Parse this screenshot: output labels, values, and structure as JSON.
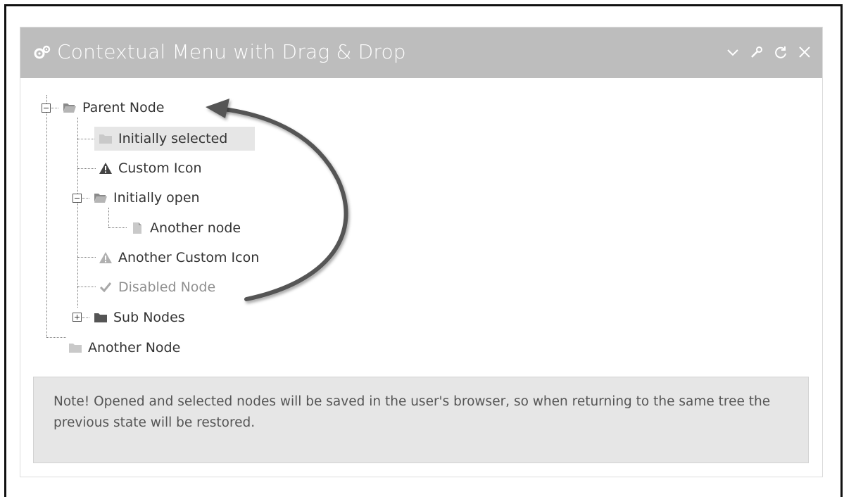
{
  "panel": {
    "title": "Contextual Menu with Drag & Drop",
    "title_icon": "cogs-icon",
    "toolbar": [
      {
        "name": "collapse",
        "icon": "chevron-down-icon"
      },
      {
        "name": "settings",
        "icon": "wrench-icon"
      },
      {
        "name": "refresh",
        "icon": "refresh-icon"
      },
      {
        "name": "close",
        "icon": "close-icon"
      }
    ]
  },
  "tree": {
    "parent": {
      "label": "Parent Node",
      "icon": "folder-open-icon",
      "expanded": true
    },
    "children": [
      {
        "label": "Initially selected",
        "icon": "folder-icon",
        "selected": true
      },
      {
        "label": "Custom Icon",
        "icon": "warning-icon"
      },
      {
        "label": "Initially open",
        "icon": "folder-open-icon",
        "expanded": true,
        "children": [
          {
            "label": "Another node",
            "icon": "file-icon"
          }
        ]
      },
      {
        "label": "Another Custom Icon",
        "icon": "warning-icon-light"
      },
      {
        "label": "Disabled Node",
        "icon": "check-icon",
        "disabled": true
      },
      {
        "label": "Sub Nodes",
        "icon": "folder-dark-icon",
        "expanded": false
      }
    ],
    "sibling": {
      "label": "Another Node",
      "icon": "folder-icon"
    }
  },
  "note": {
    "text": "Note! Opened and selected nodes will be saved in the user's browser, so when returning to the same tree the previous state will be restored."
  },
  "colors": {
    "header_bg": "#bdbdbd",
    "note_bg": "#e6e6e6",
    "selected_bg": "#e6e6e6",
    "arrow": "#555555"
  }
}
